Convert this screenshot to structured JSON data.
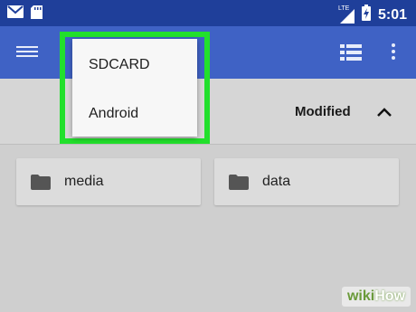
{
  "status_bar": {
    "network_label": "LTE",
    "time": "5:01"
  },
  "header": {
    "menu_icon": "hamburger-icon",
    "view_icon": "list-view-icon",
    "more_icon": "more-vert-icon",
    "bar_color": "#3f62c5",
    "status_color": "#1f3f9a"
  },
  "dropdown": {
    "items": [
      {
        "label": "SDCARD"
      },
      {
        "label": "Android"
      }
    ],
    "highlight_color": "#22e02c"
  },
  "sort": {
    "label": "Modified",
    "direction_icon": "chevron-up-icon"
  },
  "folders": [
    {
      "name": "media",
      "icon": "folder-icon"
    },
    {
      "name": "data",
      "icon": "folder-icon"
    }
  ],
  "watermark": {
    "part1": "wiki",
    "part2": "How"
  }
}
